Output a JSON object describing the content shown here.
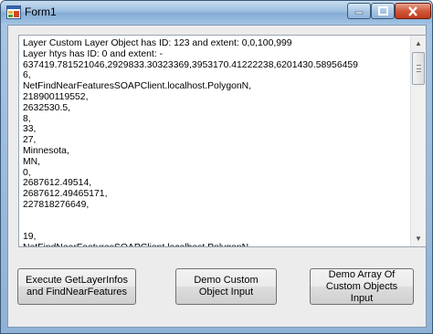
{
  "window": {
    "title": "Form1"
  },
  "output": {
    "lines": [
      "Layer Custom Layer Object has ID: 123 and extent: 0,0,100,999",
      "Layer htys has ID: 0 and extent: -",
      "637419.781521046,2929833.30323369,3953170.41222238,6201430.58956459",
      "6,",
      "NetFindNearFeaturesSOAPClient.localhost.PolygonN,",
      "218900119552,",
      "2632530.5,",
      "8,",
      "33,",
      "27,",
      "Minnesota,",
      "MN,",
      "0,",
      "2687612.49514,",
      "2687612.49465171,",
      "227818276649,",
      "",
      "",
      "19,",
      "NetFindNearFeaturesSOAPClient.localhost.PolygonN,"
    ]
  },
  "buttons": {
    "execute": "Execute GetLayerInfos and FindNearFeatures",
    "demo_custom": "Demo Custom Object Input",
    "demo_array": "Demo Array Of Custom Objects Input"
  }
}
